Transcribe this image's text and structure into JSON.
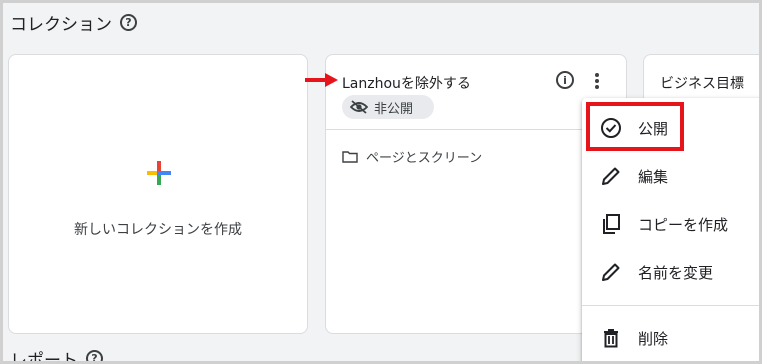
{
  "collections": {
    "title": "コレクション",
    "help_icon": "help-circle-icon"
  },
  "new_card": {
    "label": "新しいコレクションを作成",
    "icon": "google-plus-icon"
  },
  "collection_card": {
    "title": "Lanzhouを除外する",
    "status_chip": "非公開",
    "status_icon": "eye-off-icon",
    "folder_label": "ページとスクリーン"
  },
  "goal_card": {
    "title": "ビジネス目標"
  },
  "menu": {
    "items": [
      {
        "label": "公開",
        "icon": "check-circle-icon"
      },
      {
        "label": "編集",
        "icon": "pencil-icon"
      },
      {
        "label": "コピーを作成",
        "icon": "copy-icon"
      },
      {
        "label": "名前を変更",
        "icon": "pencil-icon"
      },
      {
        "label": "削除",
        "icon": "trash-icon"
      }
    ]
  },
  "reports": {
    "title": "レポート"
  },
  "colors": {
    "annotation_red": "#e5151b",
    "card_border": "#dadce0",
    "page_bg": "#f1f3f4"
  }
}
